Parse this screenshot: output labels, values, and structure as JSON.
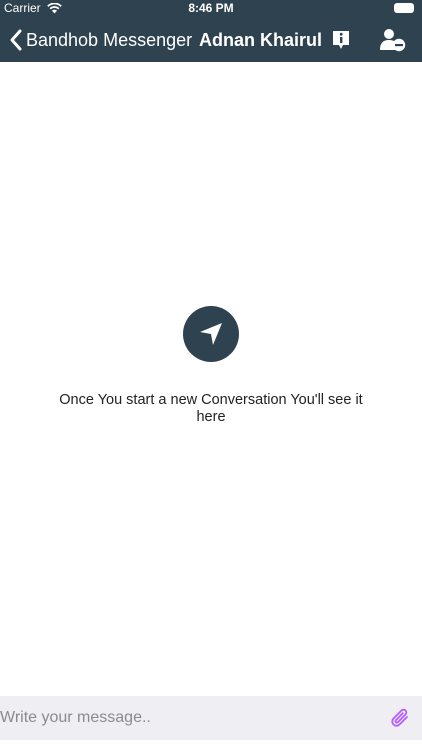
{
  "status_bar": {
    "carrier": "Carrier",
    "time": "8:46 PM"
  },
  "nav": {
    "back_label": "Bandhob Messenger",
    "title": "Adnan Khairul",
    "icons": [
      "chevron-left-icon",
      "info-icon",
      "remove-user-icon"
    ]
  },
  "empty_state": {
    "icon": "navigation-arrow-icon",
    "message": "Once You start a new Conversation You'll see it here"
  },
  "composer": {
    "placeholder": "Write your message..",
    "attach_icon": "paperclip-icon"
  },
  "colors": {
    "header_bg": "#2f4250",
    "composer_bg": "#eeeef3",
    "attach_icon": "#b45cff"
  }
}
